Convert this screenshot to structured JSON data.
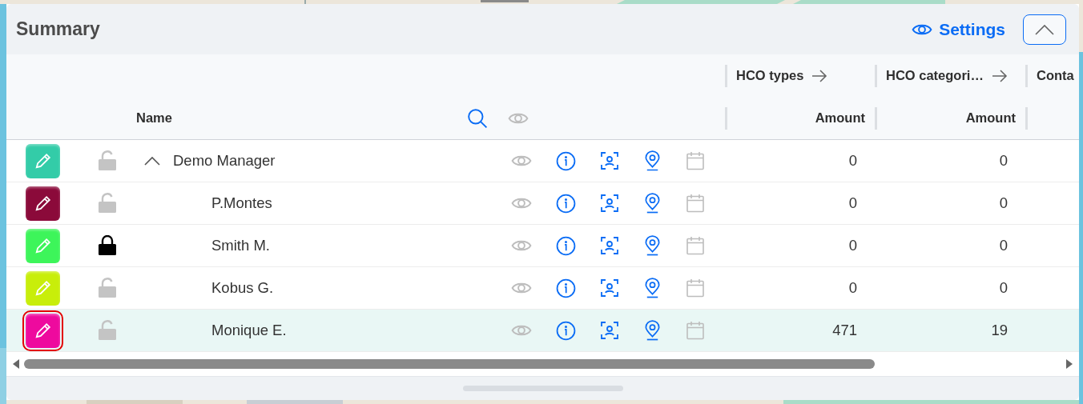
{
  "panel": {
    "title": "Summary",
    "settings_link": "Settings"
  },
  "table": {
    "group_headers": [
      "HCO types",
      "HCO categori…",
      "Conta"
    ],
    "columns": {
      "name": "Name",
      "hco_types": "Amount",
      "hco_categories": "Amount"
    },
    "rows": [
      {
        "name": "Demo Manager",
        "color": "#33cca8",
        "locked": false,
        "expanded": true,
        "selected": false,
        "focused": false,
        "hco_types": "0",
        "hco_categories": "0",
        "children": [
          {
            "name": "P.Montes",
            "color": "#8b0a3a",
            "locked": false,
            "selected": false,
            "focused": false,
            "hco_types": "0",
            "hco_categories": "0"
          },
          {
            "name": "Smith M.",
            "color": "#3df55a",
            "locked": true,
            "selected": false,
            "focused": false,
            "hco_types": "0",
            "hco_categories": "0"
          },
          {
            "name": "Kobus G.",
            "color": "#c8ee0a",
            "locked": false,
            "selected": false,
            "focused": false,
            "hco_types": "0",
            "hco_categories": "0"
          },
          {
            "name": "Monique E.",
            "color": "#ee0a9e",
            "locked": false,
            "selected": true,
            "focused": true,
            "hco_types": "471",
            "hco_categories": "19"
          }
        ]
      }
    ]
  }
}
